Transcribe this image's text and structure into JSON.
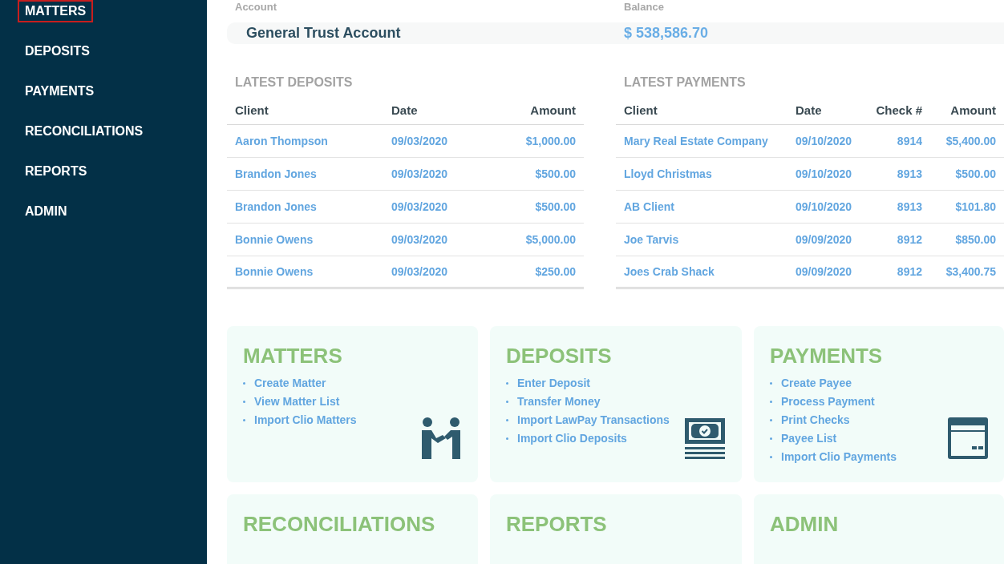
{
  "sidebar": {
    "items": [
      {
        "label": "MATTERS",
        "selected": true
      },
      {
        "label": "DEPOSITS",
        "selected": false
      },
      {
        "label": "PAYMENTS",
        "selected": false
      },
      {
        "label": "RECONCILIATIONS",
        "selected": false
      },
      {
        "label": "REPORTS",
        "selected": false
      },
      {
        "label": "ADMIN",
        "selected": false
      }
    ]
  },
  "account": {
    "columns": [
      "Account",
      "Balance"
    ],
    "name": "General Trust Account",
    "balance": "$ 538,586.70"
  },
  "latest_deposits": {
    "title": "LATEST DEPOSITS",
    "columns": [
      "Client",
      "Date",
      "Amount"
    ],
    "rows": [
      [
        "Aaron Thompson",
        "09/03/2020",
        "$1,000.00"
      ],
      [
        "Brandon Jones",
        "09/03/2020",
        "$500.00"
      ],
      [
        "Brandon Jones",
        "09/03/2020",
        "$500.00"
      ],
      [
        "Bonnie Owens",
        "09/03/2020",
        "$5,000.00"
      ],
      [
        "Bonnie Owens",
        "09/03/2020",
        "$250.00"
      ]
    ]
  },
  "latest_payments": {
    "title": "LATEST PAYMENTS",
    "columns": [
      "Client",
      "Date",
      "Check #",
      "Amount"
    ],
    "rows": [
      [
        "Mary Real Estate Company",
        "09/10/2020",
        "8914",
        "$5,400.00"
      ],
      [
        "Lloyd Christmas",
        "09/10/2020",
        "8913",
        "$500.00"
      ],
      [
        "AB Client",
        "09/10/2020",
        "8913",
        "$101.80"
      ],
      [
        "Joe Tarvis",
        "09/09/2020",
        "8912",
        "$850.00"
      ],
      [
        "Joes Crab Shack",
        "09/09/2020",
        "8912",
        "$3,400.75"
      ]
    ]
  },
  "cards": [
    {
      "title": "MATTERS",
      "kind": "handshake",
      "links": [
        "Create Matter",
        "View Matter List",
        "Import Clio Matters"
      ]
    },
    {
      "title": "DEPOSITS",
      "kind": "money",
      "links": [
        "Enter Deposit",
        "Transfer Money",
        "Import LawPay Transactions",
        "Import Clio Deposits"
      ]
    },
    {
      "title": "PAYMENTS",
      "kind": "card",
      "links": [
        "Create Payee",
        "Process Payment",
        "Print Checks",
        "Payee List",
        "Import Clio Payments"
      ]
    },
    {
      "title": "RECONCILIATIONS",
      "kind": "none"
    },
    {
      "title": "REPORTS",
      "kind": "none"
    },
    {
      "title": "ADMIN",
      "kind": "none"
    }
  ]
}
